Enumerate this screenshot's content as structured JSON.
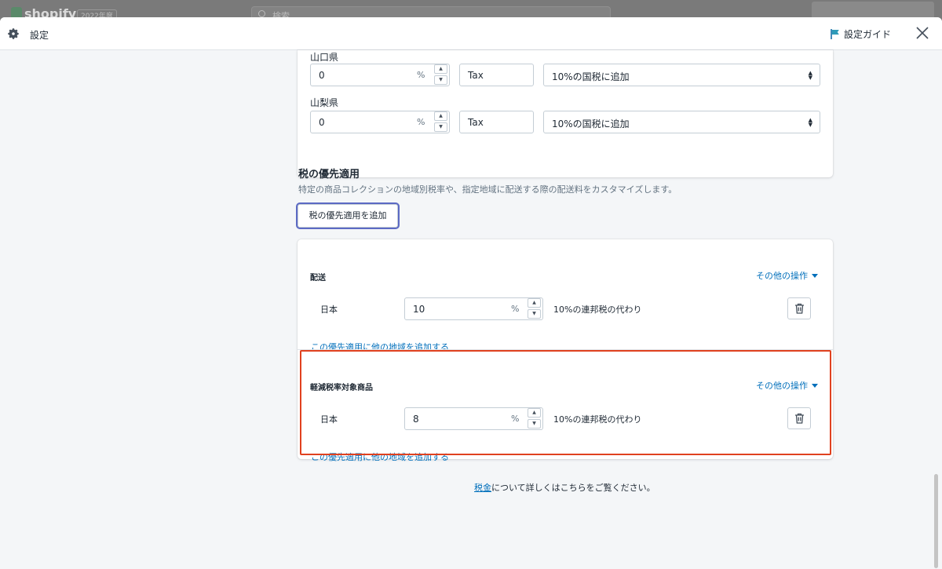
{
  "topbar": {
    "logo": "shopify",
    "edition": "2022年度",
    "search_placeholder": "検索"
  },
  "modal": {
    "title": "設定",
    "guide_label": "設定ガイド"
  },
  "provinces": [
    {
      "name": "山口県",
      "rate": "0",
      "percent": "%",
      "tax_name": "Tax",
      "calc": "10%の国税に追加"
    },
    {
      "name": "山梨県",
      "rate": "0",
      "percent": "%",
      "tax_name": "Tax",
      "calc": "10%の国税に追加"
    }
  ],
  "overrides_section": {
    "title": "税の優先適用",
    "description": "特定の商品コレクションの地域別税率や、指定地域に配送する際の配送料をカスタマイズします。",
    "add_button": "税の優先適用を追加"
  },
  "overrides": [
    {
      "title": "配送",
      "action": "その他の操作",
      "region": "日本",
      "rate": "10",
      "percent": "%",
      "desc": "10%の連邦税の代わり",
      "add_link": "この優先適用に他の地域を追加する"
    },
    {
      "title": "軽減税率対象商品",
      "action": "その他の操作",
      "region": "日本",
      "rate": "8",
      "percent": "%",
      "desc": "10%の連邦税の代わり",
      "add_link": "この優先適用に他の地域を追加する"
    }
  ],
  "footer": {
    "link": "税金",
    "text": "について詳しくはこちらをご覧ください。"
  },
  "colors": {
    "link": "#006fbb",
    "highlight": "#e0411f",
    "focus_ring": "#5c6ac4"
  }
}
